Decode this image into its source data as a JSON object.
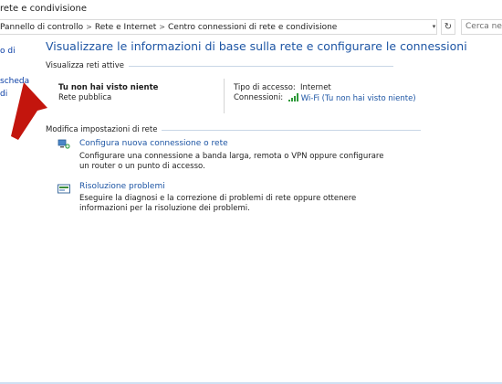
{
  "window": {
    "title": "rete e condivisione"
  },
  "address": {
    "crumbs": [
      "Pannello di controllo",
      "Rete e Internet",
      "Centro connessioni di rete e condivisione"
    ],
    "separator": ">",
    "search_placeholder": "Cerca nel Pann"
  },
  "sidebar": {
    "items": [
      {
        "label": "o di"
      },
      {
        "label": "scheda"
      },
      {
        "label": "di"
      }
    ]
  },
  "main": {
    "title": "Visualizzare le informazioni di base sulla rete e configurare le connessioni",
    "active_networks_header": "Visualizza reti attive",
    "network": {
      "name": "Tu non hai visto niente",
      "type": "Rete pubblica",
      "access_label": "Tipo di accesso:",
      "access_value": "Internet",
      "connections_label": "Connessioni:",
      "connection_value": "Wi-Fi (Tu non hai visto niente)"
    },
    "change_settings_header": "Modifica impostazioni di rete",
    "tasks": [
      {
        "link": "Configura nuova connessione o rete",
        "desc": "Configurare una connessione a banda larga, remota o VPN oppure configurare un router o un punto di accesso."
      },
      {
        "link": "Risoluzione problemi",
        "desc": "Eseguire la diagnosi e la correzione di problemi di rete oppure ottenere informazioni per la risoluzione dei problemi."
      }
    ]
  },
  "colors": {
    "link": "#1d55a4",
    "sidebar_link": "#0a3ea6",
    "arrow": "#c3150d"
  },
  "icons": [
    "refresh-icon",
    "chevron-down-icon",
    "wifi-signal-icon",
    "new-connection-icon",
    "troubleshoot-icon",
    "red-arrow"
  ]
}
